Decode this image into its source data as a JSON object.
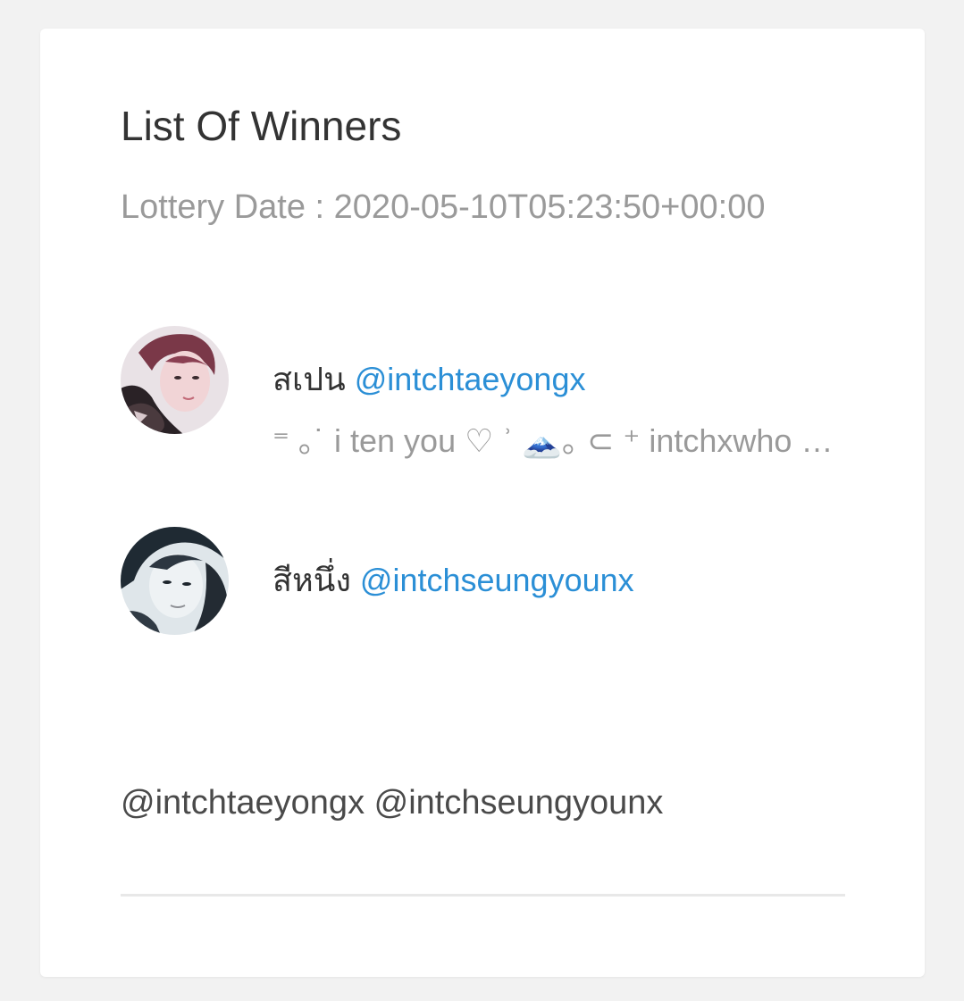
{
  "card": {
    "title": "List Of Winners",
    "lottery_date": "Lottery Date : 2020-05-10T05:23:50+00:00"
  },
  "winners": [
    {
      "display_name": "สเปน",
      "handle": "@intchtaeyongx",
      "bio": "⁼ ｡˙ i ten you ♡ ʾ 🗻｡ ⊂ ⁺ intchxwho ⁼ ˙ ʾ",
      "avatar_icon": "user-avatar-photo"
    },
    {
      "display_name": "สีหนึ่ง",
      "handle": "@intchseungyounx",
      "bio": "",
      "avatar_icon": "user-avatar-photo"
    }
  ],
  "mentions": "@intchtaeyongx @intchseungyounx",
  "colors": {
    "background": "#f2f2f2",
    "card": "#ffffff",
    "link": "#2b8fd6",
    "title": "#333333",
    "muted": "#9a9a9a"
  }
}
